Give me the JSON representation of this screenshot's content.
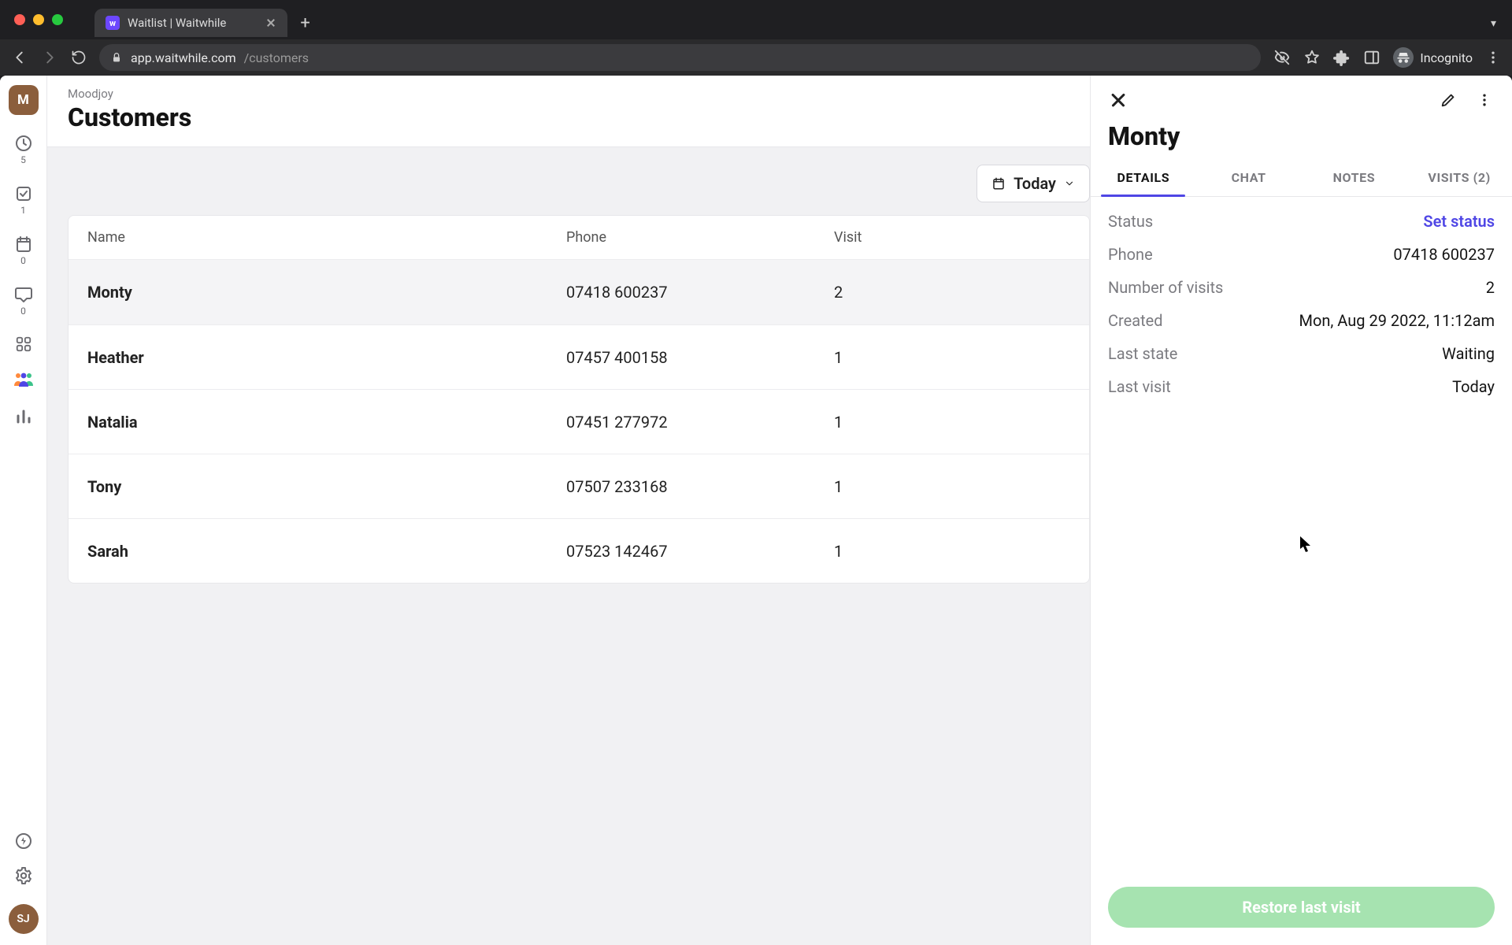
{
  "browser": {
    "tab_title": "Waitlist | Waitwhile",
    "favicon_letter": "w",
    "url_host": "app.waitwhile.com",
    "url_path": "/customers",
    "incognito_label": "Incognito"
  },
  "rail": {
    "logo_letter": "M",
    "items": [
      {
        "id": "clock",
        "badge": "5"
      },
      {
        "id": "checkbox",
        "badge": "1"
      },
      {
        "id": "calendar",
        "badge": "0"
      },
      {
        "id": "chat",
        "badge": "0"
      },
      {
        "id": "apps",
        "badge": ""
      },
      {
        "id": "people",
        "badge": "",
        "active": true
      },
      {
        "id": "stats",
        "badge": ""
      }
    ],
    "avatar_initials": "SJ"
  },
  "header": {
    "breadcrumb": "Moodjoy",
    "title": "Customers"
  },
  "toolbar": {
    "date_label": "Today"
  },
  "table": {
    "columns": {
      "name": "Name",
      "phone": "Phone",
      "visit": "Visit"
    },
    "rows": [
      {
        "name": "Monty",
        "phone": "07418 600237",
        "visit": "2",
        "selected": true
      },
      {
        "name": "Heather",
        "phone": "07457 400158",
        "visit": "1"
      },
      {
        "name": "Natalia",
        "phone": "07451 277972",
        "visit": "1"
      },
      {
        "name": "Tony",
        "phone": "07507 233168",
        "visit": "1"
      },
      {
        "name": "Sarah",
        "phone": "07523 142467",
        "visit": "1"
      }
    ]
  },
  "panel": {
    "title": "Monty",
    "tabs": {
      "details": "DETAILS",
      "chat": "CHAT",
      "notes": "NOTES",
      "visits": "VISITS (2)"
    },
    "details": {
      "status_label": "Status",
      "status_value": "Set status",
      "phone_label": "Phone",
      "phone_value": "07418 600237",
      "visits_label": "Number of visits",
      "visits_value": "2",
      "created_label": "Created",
      "created_value": "Mon, Aug 29 2022, 11:12am",
      "laststate_label": "Last state",
      "laststate_value": "Waiting",
      "lastvisit_label": "Last visit",
      "lastvisit_value": "Today"
    },
    "restore_label": "Restore last visit"
  }
}
